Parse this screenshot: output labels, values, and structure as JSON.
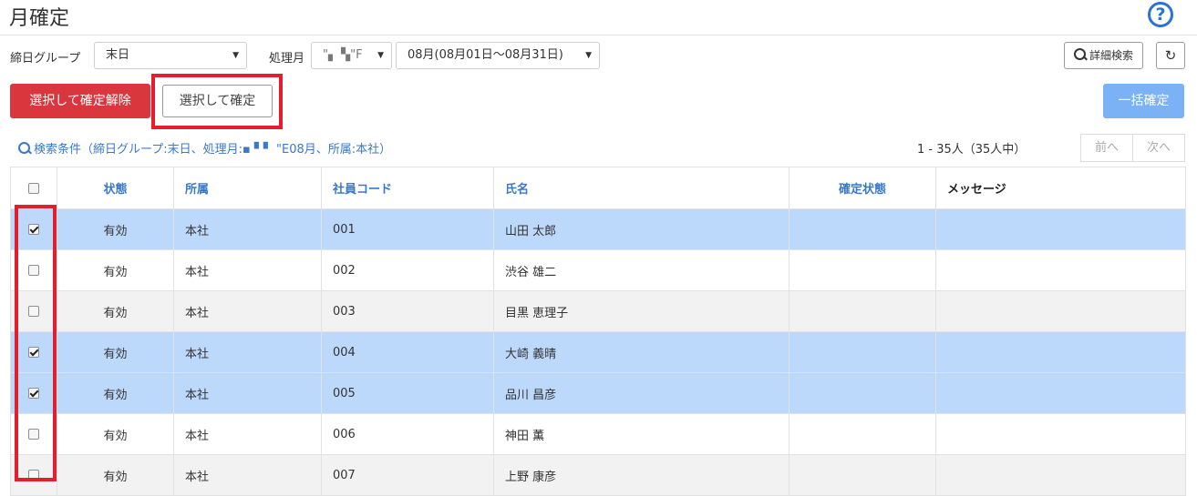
{
  "header": {
    "title": "月確定",
    "help_glyph": "?"
  },
  "filters": {
    "closing_group_label": "締日グループ",
    "closing_group_value": "末日",
    "month_label": "処理月",
    "year_value": "\"▖ ▚\"F",
    "month_value": "08月(08月01日～08月31日)",
    "caret": "▼"
  },
  "toolbar": {
    "detail_search_label": "詳細検索",
    "refresh_glyph": "↻",
    "unconfirm_label": "選択して確定解除",
    "confirm_label": "選択して確定",
    "bulk_confirm_label": "一括確定"
  },
  "results": {
    "search_condition": "検索条件（締日グループ:末日、処理月:▪ ▘▘ \"E08月、所属:本社）",
    "count": "1 - 35人（35人中）",
    "prev_label": "前へ",
    "next_label": "次へ"
  },
  "table": {
    "columns": {
      "status": "状態",
      "department": "所属",
      "code": "社員コード",
      "name": "氏名",
      "confirm_state": "確定状態",
      "message": "メッセージ"
    },
    "rows": [
      {
        "checked": true,
        "status": "有効",
        "department": "本社",
        "code": "001",
        "name": "山田 太郎",
        "confirm_state": "",
        "message": ""
      },
      {
        "checked": false,
        "status": "有効",
        "department": "本社",
        "code": "002",
        "name": "渋谷 雄二",
        "confirm_state": "",
        "message": ""
      },
      {
        "checked": false,
        "status": "有効",
        "department": "本社",
        "code": "003",
        "name": "目黒 恵理子",
        "confirm_state": "",
        "message": ""
      },
      {
        "checked": true,
        "status": "有効",
        "department": "本社",
        "code": "004",
        "name": "大崎 義晴",
        "confirm_state": "",
        "message": ""
      },
      {
        "checked": true,
        "status": "有効",
        "department": "本社",
        "code": "005",
        "name": "品川 昌彦",
        "confirm_state": "",
        "message": ""
      },
      {
        "checked": false,
        "status": "有効",
        "department": "本社",
        "code": "006",
        "name": "神田 薫",
        "confirm_state": "",
        "message": ""
      },
      {
        "checked": false,
        "status": "有効",
        "department": "本社",
        "code": "007",
        "name": "上野 康彦",
        "confirm_state": "",
        "message": ""
      }
    ]
  },
  "colors": {
    "accent_blue": "#3a79c9",
    "danger_red": "#d9363e",
    "selected_row": "#bcd8fb",
    "annotation_red": "#e21f2d"
  }
}
